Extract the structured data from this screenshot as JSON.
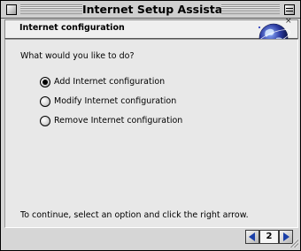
{
  "window": {
    "title": "Internet Setup Assistant"
  },
  "header": {
    "title": "Internet configuration",
    "close_glyph": "×",
    "graphic_icon": "globe-icon"
  },
  "main": {
    "question": "What would you like to do?",
    "options": [
      {
        "label": "Add Internet configuration",
        "selected": true
      },
      {
        "label": "Modify Internet configuration",
        "selected": false
      },
      {
        "label": "Remove Internet configuration",
        "selected": false
      }
    ],
    "hint": "To continue, select an option and click the right arrow."
  },
  "nav": {
    "page_number": "2",
    "back_icon": "left-arrow-icon",
    "forward_icon": "right-arrow-icon"
  },
  "colors": {
    "arrow": "#1a3fa8",
    "globe": "#2b3aa0"
  }
}
